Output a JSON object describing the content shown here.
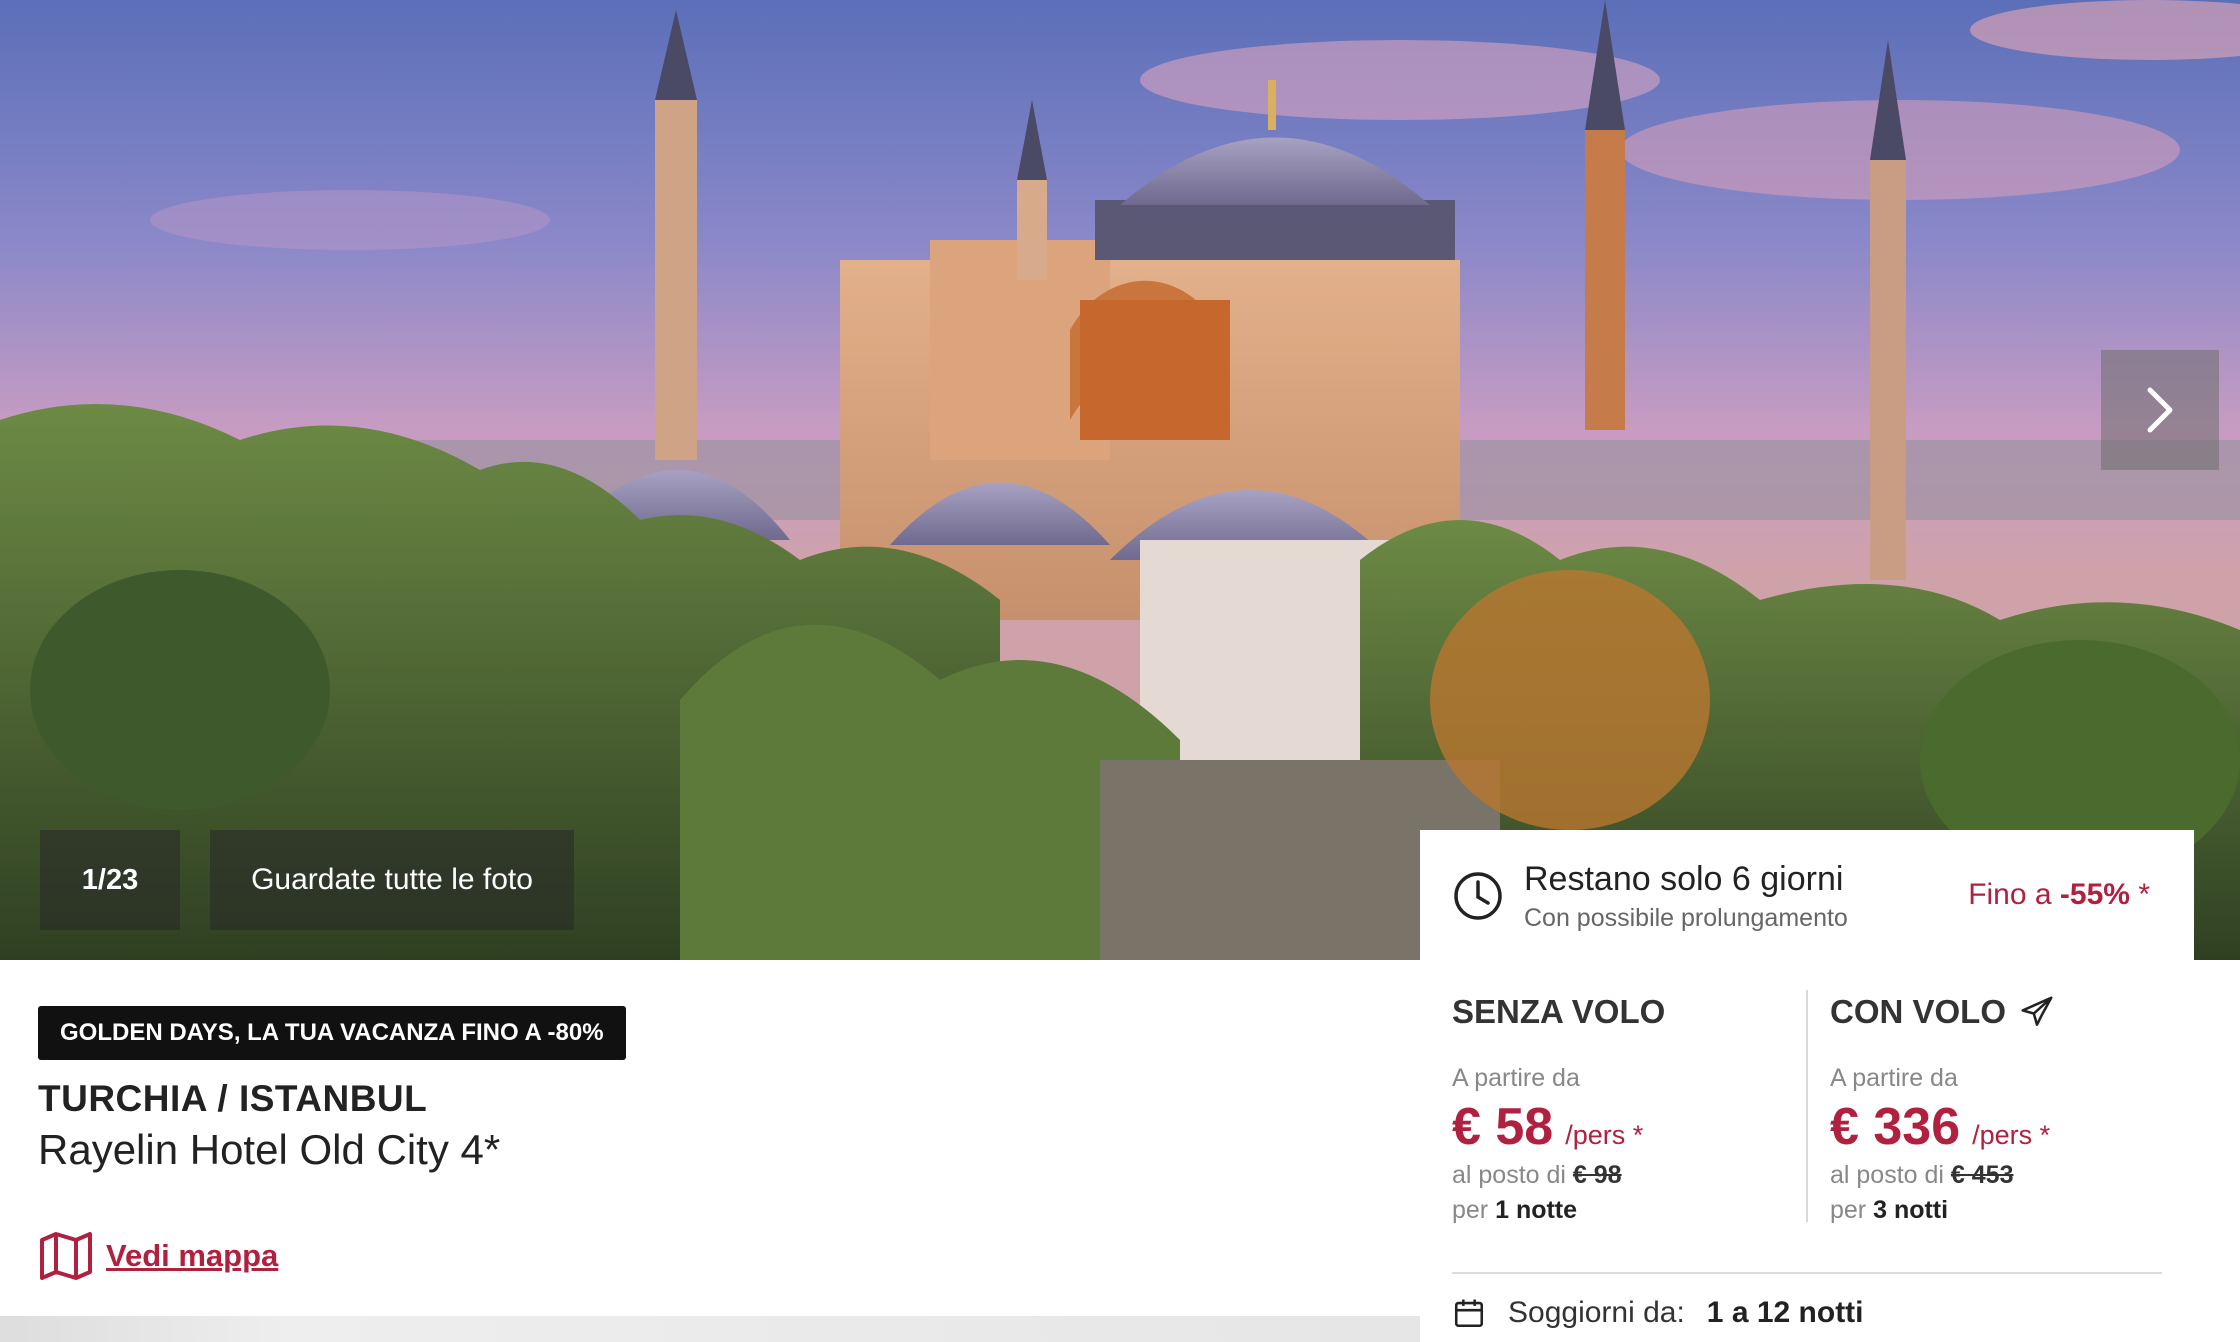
{
  "gallery": {
    "counter": "1/23",
    "all_photos_label": "Guardate tutte le foto",
    "next_icon": "chevron-right-icon"
  },
  "deal": {
    "title": "Restano solo 6 giorni",
    "subtitle": "Con possibile prolungamento",
    "discount_prefix": "Fino a",
    "discount_value": "-55%",
    "discount_suffix": "*",
    "icon": "clock-icon"
  },
  "offers": [
    {
      "title": "SENZA VOLO",
      "from_label": "A partire da",
      "price": "€ 58",
      "per": "/pers *",
      "instead_prefix": "al posto di",
      "old_price": "€ 98",
      "nights_prefix": "per",
      "nights": "1 notte"
    },
    {
      "title": "CON VOLO",
      "icon": "airplane-icon",
      "from_label": "A partire da",
      "price": "€ 336",
      "per": "/pers *",
      "instead_prefix": "al posto di",
      "old_price": "€ 453",
      "nights_prefix": "per",
      "nights": "3 notti"
    }
  ],
  "stay": {
    "label": "Soggiorni da:",
    "value": "1 a 12 notti",
    "icon": "calendar-icon"
  },
  "info": {
    "badge": "GOLDEN DAYS, LA TUA VACANZA FINO A -80%",
    "destination": "TURCHIA / ISTANBUL",
    "hotel": "Rayelin Hotel Old City 4*",
    "map_label": "Vedi mappa",
    "map_icon": "map-icon"
  },
  "colors": {
    "accent": "#b0203f",
    "badge_bg": "#111111"
  }
}
